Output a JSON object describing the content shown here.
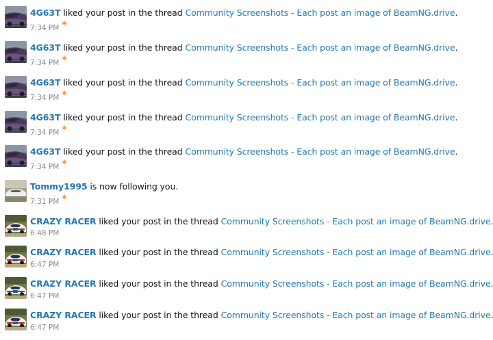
{
  "alerts": [
    {
      "user": "4G63T",
      "action": " liked your post in the thread ",
      "thread": "Community Screenshots - Each post an image of BeamNG.drive",
      "suffix": ".",
      "time": "7:34 PM",
      "unread": true,
      "avatar": "purple-car"
    },
    {
      "user": "4G63T",
      "action": " liked your post in the thread ",
      "thread": "Community Screenshots - Each post an image of BeamNG.drive",
      "suffix": ".",
      "time": "7:34 PM",
      "unread": true,
      "avatar": "purple-car"
    },
    {
      "user": "4G63T",
      "action": " liked your post in the thread ",
      "thread": "Community Screenshots - Each post an image of BeamNG.drive",
      "suffix": ".",
      "time": "7:34 PM",
      "unread": true,
      "avatar": "purple-car"
    },
    {
      "user": "4G63T",
      "action": " liked your post in the thread ",
      "thread": "Community Screenshots - Each post an image of BeamNG.drive",
      "suffix": ".",
      "time": "7:34 PM",
      "unread": true,
      "avatar": "purple-car"
    },
    {
      "user": "4G63T",
      "action": " liked your post in the thread ",
      "thread": "Community Screenshots - Each post an image of BeamNG.drive",
      "suffix": ".",
      "time": "7:34 PM",
      "unread": true,
      "avatar": "purple-car"
    },
    {
      "user": "Tommy1995",
      "action": " is now following you.",
      "thread": "",
      "suffix": "",
      "time": "7:31 PM",
      "unread": true,
      "avatar": "white-car"
    },
    {
      "user": "CRAZY RACER",
      "action": " liked your post in the thread ",
      "thread": "Community Screenshots - Each post an image of BeamNG.drive",
      "suffix": ".",
      "time": "6:48 PM",
      "unread": false,
      "avatar": "rally-car"
    },
    {
      "user": "CRAZY RACER",
      "action": " liked your post in the thread ",
      "thread": "Community Screenshots - Each post an image of BeamNG.drive",
      "suffix": ".",
      "time": "6:47 PM",
      "unread": false,
      "avatar": "rally-car"
    },
    {
      "user": "CRAZY RACER",
      "action": " liked your post in the thread ",
      "thread": "Community Screenshots - Each post an image of BeamNG.drive",
      "suffix": ".",
      "time": "6:47 PM",
      "unread": false,
      "avatar": "rally-car"
    },
    {
      "user": "CRAZY RACER",
      "action": " liked your post in the thread ",
      "thread": "Community Screenshots - Each post an image of BeamNG.drive",
      "suffix": ".",
      "time": "6:47 PM",
      "unread": false,
      "avatar": "rally-car"
    }
  ],
  "unread_marker": "*",
  "colors": {
    "link": "#2577b1",
    "meta": "#8c8c8c",
    "unread_marker": "#f08a24",
    "text": "#141414"
  }
}
